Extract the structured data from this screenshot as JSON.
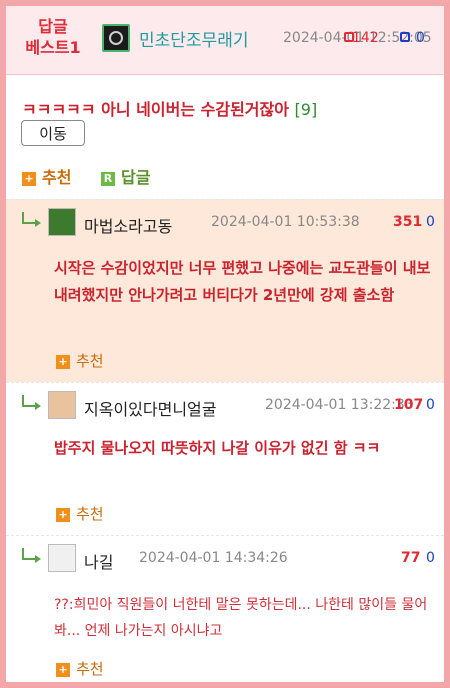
{
  "header": {
    "badge": "답글\n베스트1",
    "badge_line1": "답글",
    "badge_line2": "베스트1",
    "author": "민초단조무래기",
    "date": "2024-04-01 12:52:05",
    "likes": "142",
    "dislikes": "0"
  },
  "post": {
    "title": "ㅋㅋㅋㅋㅋ 아니 네이버는 수감된거잖아",
    "comment_count": "[9]",
    "move_button": "이동",
    "recommend_label": "추천",
    "reply_label": "답글"
  },
  "comments": [
    {
      "author": "마법소라고동",
      "date": "2024-04-01 10:53:38",
      "likes": "351",
      "dislikes": "0",
      "text": "시작은 수감이었지만 너무 편했고 나중에는 교도관들이 내보내려했지만 안나가려고 버티다가 2년만에 강제 출소함",
      "recommend_label": "추천"
    },
    {
      "author": "지옥이있다면니얼굴",
      "date": "2024-04-01 13:22:33",
      "likes": "107",
      "dislikes": "0",
      "text": "밥주지 물나오지 따뜻하지 나갈 이유가 없긴 함 ㅋㅋ",
      "recommend_label": "추천"
    },
    {
      "author": "나길",
      "date": "2024-04-01 14:34:26",
      "likes": "77",
      "dislikes": "0",
      "text": "??:희민아 직원들이 너한테 말은 못하는데... 나한테 많이들 물어봐... 언제 나가는지 아시냐고",
      "recommend_label": "추천"
    }
  ],
  "icons": {
    "recommend": "plus-square-icon",
    "reply": "r-square-icon",
    "reply_arrow": "reply-arrow-icon",
    "like": "thumbs-up-icon",
    "dislike": "thumbs-down-icon"
  },
  "colors": {
    "frame": "#f4a7a9",
    "header_bg": "#fdeaec",
    "highlight_bg": "#fde8d9",
    "title_red": "#c9232f",
    "author_teal": "#1e9aa0",
    "dislike_blue": "#1c3ec9"
  }
}
